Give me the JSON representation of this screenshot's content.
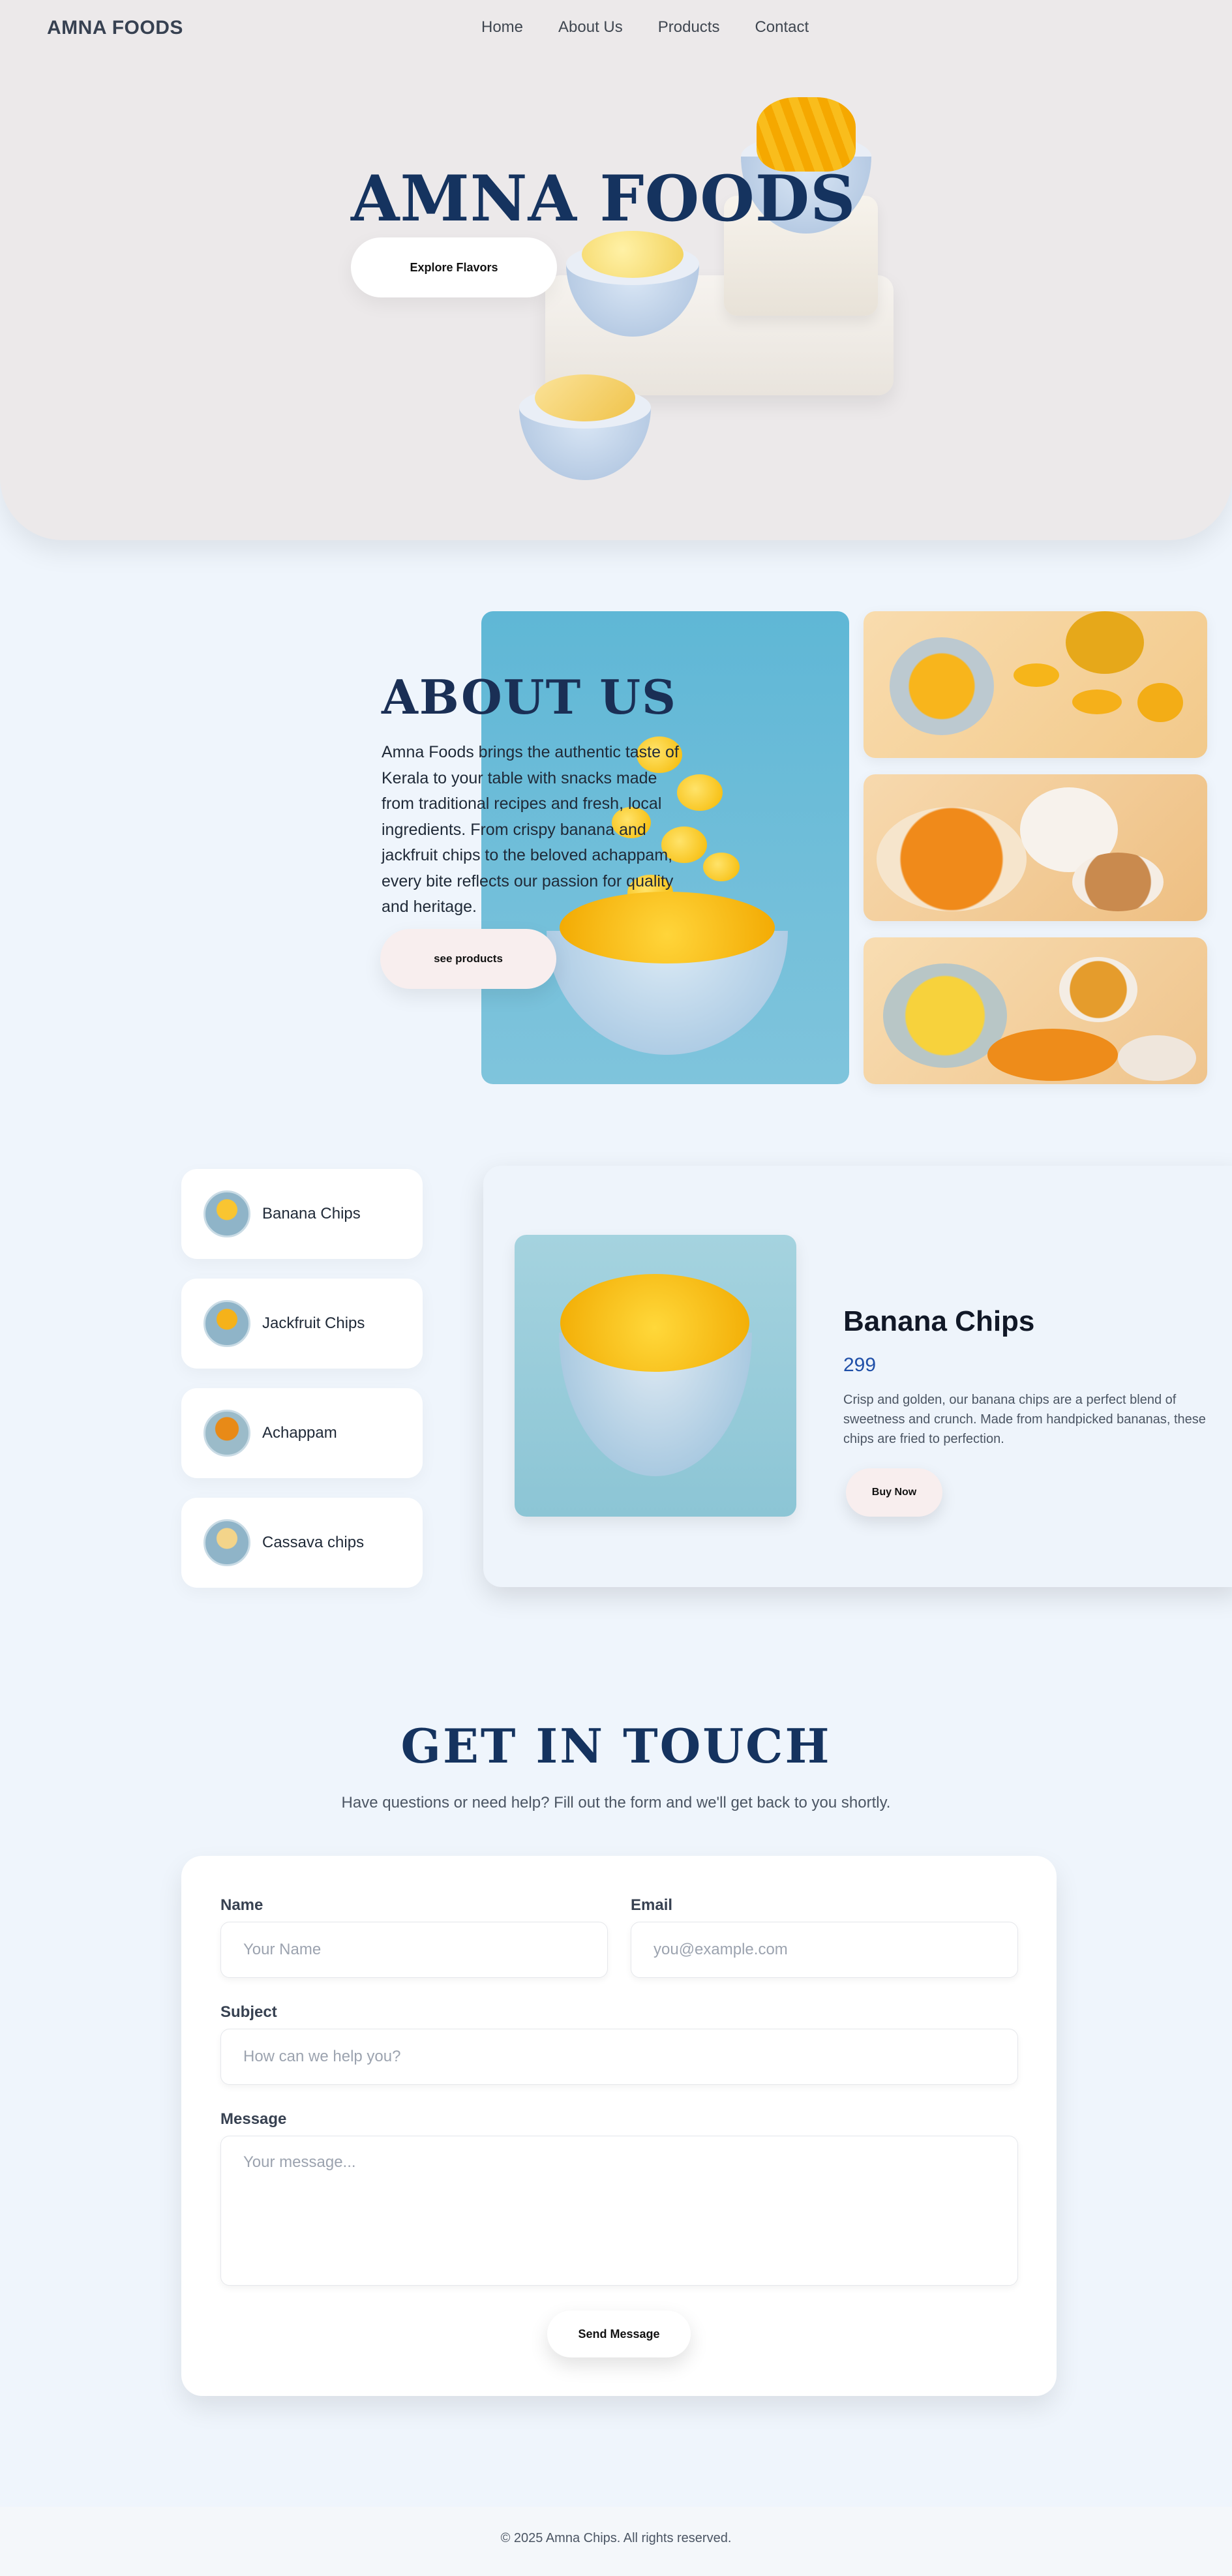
{
  "brand": "AMNA FOODS",
  "nav": [
    "Home",
    "About Us",
    "Products",
    "Contact"
  ],
  "hero": {
    "title": "AMNA FOODS",
    "cta": "Explore Flavors"
  },
  "about": {
    "title": "ABOUT US",
    "text": "Amna Foods brings the authentic taste of Kerala to your table with snacks made from traditional recipes and fresh, local ingredients. From crispy banana and jackfruit chips to the beloved achappam, every bite reflects our passion for quality and heritage.",
    "cta": "see products"
  },
  "products": {
    "list": [
      {
        "name": "Banana Chips"
      },
      {
        "name": "Jackfruit Chips"
      },
      {
        "name": "Achappam"
      },
      {
        "name": "Cassava chips"
      }
    ],
    "selected": {
      "name": "Banana Chips",
      "price": "299",
      "description": "Crisp and golden, our banana chips are a perfect blend of sweetness and crunch. Made from handpicked bananas, these chips are fried to perfection.",
      "cta": "Buy Now"
    }
  },
  "contact": {
    "title": "GET IN TOUCH",
    "subtitle": "Have questions or need help? Fill out the form and we'll get back to you shortly.",
    "fields": {
      "name_label": "Name",
      "name_placeholder": "Your Name",
      "email_label": "Email",
      "email_placeholder": "you@example.com",
      "subject_label": "Subject",
      "subject_placeholder": "How can we help you?",
      "message_label": "Message",
      "message_placeholder": "Your message..."
    },
    "submit": "Send Message"
  },
  "footer": "© 2025 Amna Chips. All rights reserved.",
  "colors": {
    "brand_navy": "#15335f",
    "price_blue": "#1f4fa8",
    "page_bg": "#eff5fc",
    "hero_bg": "#ece9ea"
  }
}
